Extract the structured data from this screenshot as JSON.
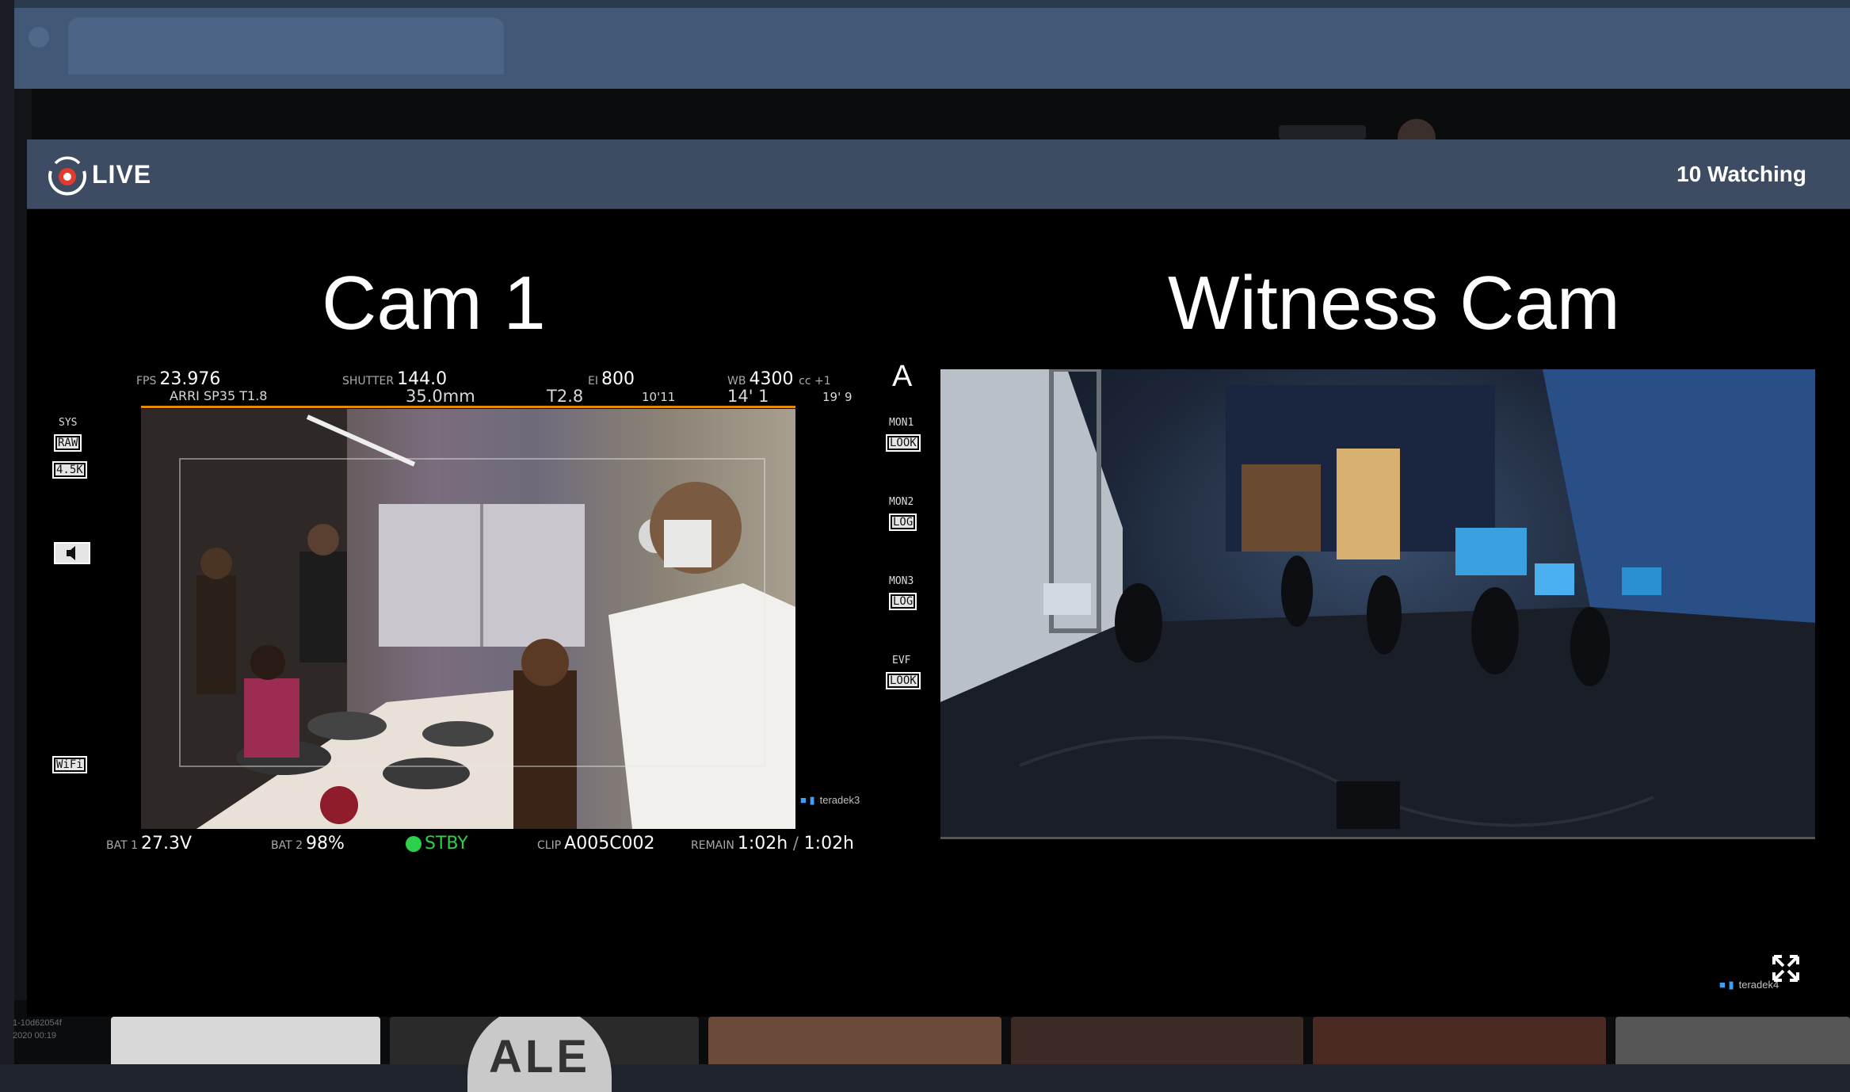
{
  "modal": {
    "live_label": "LIVE",
    "watching_label": "10 Watching"
  },
  "cam1": {
    "title": "Cam 1",
    "hud": {
      "fps_label": "FPS",
      "fps": "23.976",
      "lens": "ARRI SP35 T1.8",
      "shutter_label": "SHUTTER",
      "shutter": "144.0",
      "focal": "35.0mm",
      "ei_label": "EI",
      "ei": "800",
      "tstop": "T2.8",
      "dist1": "10'11",
      "wb_label": "WB",
      "wb": "4300",
      "cc": "cc +1",
      "dist2": "14' 1",
      "dist3": "19' 9",
      "camera_letter": "A",
      "sys_label": "SYS",
      "raw_label": "RAW",
      "res_label": "4.5K",
      "wifi_label": "WiFi",
      "mon1_label": "MON1",
      "mon1_mode": "LOOK",
      "mon2_label": "MON2",
      "mon2_mode": "LOG",
      "mon3_label": "MON3",
      "mon3_mode": "LOG",
      "evf_label": "EVF",
      "evf_mode": "LOOK",
      "bat1_label": "BAT 1",
      "bat1": "27.3V",
      "bat2_label": "BAT 2",
      "bat2": "98%",
      "status": "STBY",
      "clip_label": "CLIP",
      "clip": "A005C002",
      "remain_label": "REMAIN",
      "remain": "1:02h",
      "remain_sep": "/",
      "remain2": "1:02h"
    },
    "source_tag": "teradek3"
  },
  "witness": {
    "title": "Witness Cam",
    "source_tag": "teradek4"
  },
  "background": {
    "ale_badge": "ALE",
    "side_id": "1-10d62054f",
    "side_date": "2020 00:19"
  },
  "colors": {
    "header": "#3d4c62",
    "browser": "#415877",
    "status_green": "#2bd04b",
    "frame_orange": "#e68a00"
  }
}
